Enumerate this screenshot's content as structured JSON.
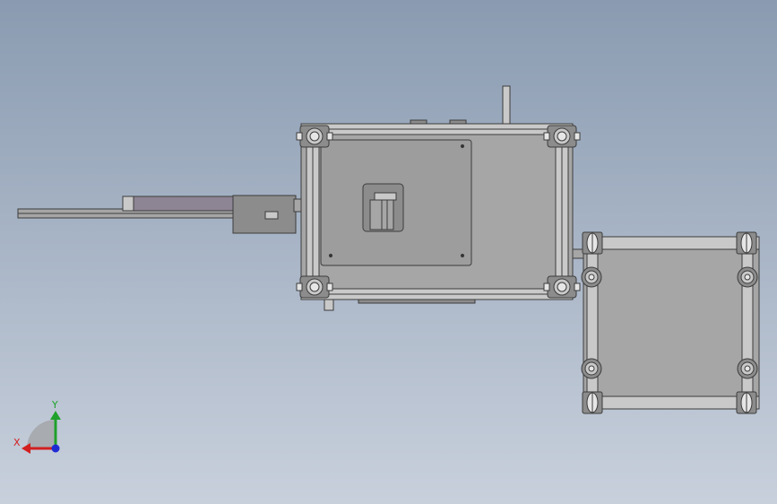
{
  "viewport": {
    "background_top": "#8a9bb1",
    "background_bottom": "#c8d0dc"
  },
  "colors": {
    "frame_face": "#a6a6a6",
    "frame_edge": "#3c3c3c",
    "rail_light": "#c9c9c9",
    "panel_face": "#9d9d9d",
    "motor_face": "#8c8c8c",
    "arm_tint": "#8d8494",
    "caster_wheel": "#e6e6e6",
    "axis_x": "#d21f1f",
    "axis_y": "#1fa12b",
    "axis_z": "#1f2bd2",
    "triad_plane": "#9e9e9e"
  },
  "triad": {
    "x_label": "X",
    "y_label": "Y"
  },
  "icons": [
    "coordinate-triad-icon",
    "caster-wheel-icon",
    "servo-motor-icon"
  ]
}
